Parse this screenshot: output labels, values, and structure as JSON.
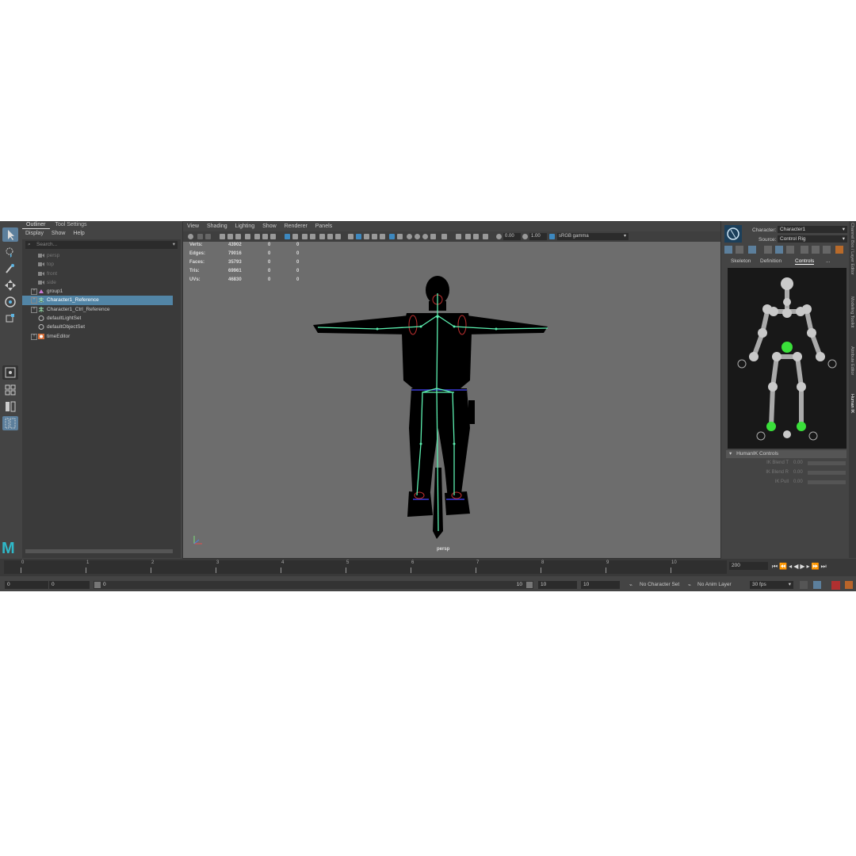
{
  "outliner": {
    "tabs": [
      "Outliner",
      "Tool Settings"
    ],
    "menu": [
      "Display",
      "Show",
      "Help"
    ],
    "search_placeholder": "Search...",
    "items": [
      {
        "label": "persp",
        "type": "camera",
        "dim": true
      },
      {
        "label": "top",
        "type": "camera",
        "dim": true
      },
      {
        "label": "front",
        "type": "camera",
        "dim": true
      },
      {
        "label": "side",
        "type": "camera",
        "dim": true
      },
      {
        "label": "group1",
        "type": "group",
        "dim": false
      },
      {
        "label": "Character1_Reference",
        "type": "skeleton",
        "dim": false,
        "selected": true
      },
      {
        "label": "Character1_Ctrl_Reference",
        "type": "skeleton",
        "dim": false
      },
      {
        "label": "defaultLightSet",
        "type": "set",
        "dim": false
      },
      {
        "label": "defaultObjectSet",
        "type": "set",
        "dim": false
      },
      {
        "label": "timeEditor",
        "type": "editor",
        "dim": false
      }
    ]
  },
  "viewport": {
    "menu": [
      "View",
      "Shading",
      "Lighting",
      "Show",
      "Renderer",
      "Panels"
    ],
    "exposure": "0.00",
    "gamma": "1.00",
    "color_space": "sRGB gamma",
    "camera_label": "persp",
    "hud": [
      {
        "label": "Verts:",
        "v1": "43902",
        "v2": "0",
        "v3": "0"
      },
      {
        "label": "Edges:",
        "v1": "79016",
        "v2": "0",
        "v3": "0"
      },
      {
        "label": "Faces:",
        "v1": "35793",
        "v2": "0",
        "v3": "0"
      },
      {
        "label": "Tris:",
        "v1": "69961",
        "v2": "0",
        "v3": "0"
      },
      {
        "label": "UVs:",
        "v1": "46830",
        "v2": "0",
        "v3": "0"
      }
    ]
  },
  "hik": {
    "character_label": "Character:",
    "character_value": "Character1",
    "source_label": "Source:",
    "source_value": "Control Rig",
    "tabs": [
      "Skeleton",
      "Definition",
      "Controls",
      "..."
    ],
    "controls_title": "HumanIK Controls",
    "sliders": [
      {
        "label": "IK Blend T",
        "value": "0.00"
      },
      {
        "label": "IK Blend R",
        "value": "0.00"
      },
      {
        "label": "IK Pull",
        "value": "0.00"
      }
    ],
    "side_tabs": [
      "Channel Box / Layer Editor",
      "Modeling Toolkit",
      "Attribute Editor",
      "Human IK"
    ]
  },
  "timeline": {
    "ticks": [
      "0",
      "1",
      "2",
      "3",
      "4",
      "5",
      "6",
      "7",
      "8",
      "9",
      "10"
    ],
    "current_frame": "200"
  },
  "range": {
    "start": "0",
    "inner_start": "0",
    "slider_start": "0",
    "slider_end": "10",
    "end1": "10",
    "end2": "10",
    "character_set": "No Character Set",
    "anim_layer": "No Anim Layer",
    "fps": "30 fps"
  },
  "logo_letter": "M",
  "accent": "#5285a6"
}
